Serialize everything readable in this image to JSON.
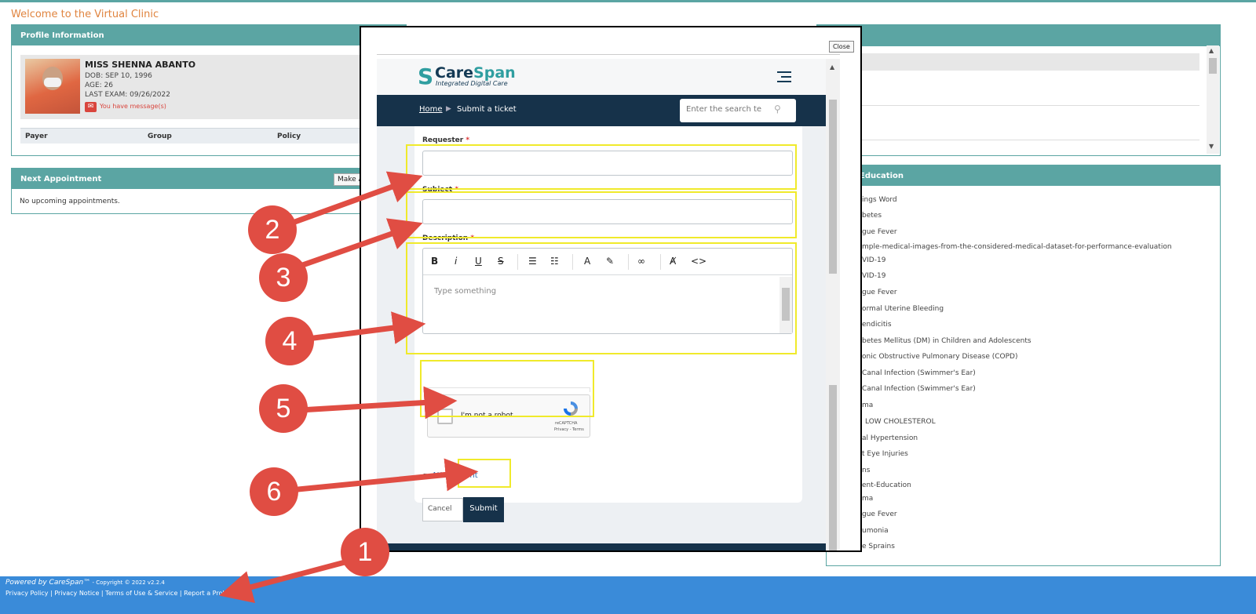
{
  "welcome": "Welcome to the Virtual Clinic",
  "profile": {
    "title": "Profile Information",
    "name": "MISS SHENNA ABANTO",
    "dob": "DOB: SEP 10, 1996",
    "age": "AGE: 26",
    "last_exam": "LAST EXAM: 09/26/2022",
    "message": "You have message(s)",
    "table_headers": [
      "Payer",
      "Group",
      "Policy"
    ]
  },
  "appointment": {
    "title": "Next Appointment",
    "make_button": "Make A",
    "empty": "No upcoming appointments."
  },
  "education": {
    "title": "Education",
    "items": [
      "ings Word",
      "betes",
      "gue Fever",
      "mple-medical-images-from-the-considered-medical-dataset-for-performance-evaluation",
      "VID-19",
      "VID-19",
      "gue Fever",
      "ormal Uterine Bleeding",
      "endicitis",
      "betes Mellitus (DM) in Children and Adolescents",
      "onic Obstructive Pulmonary Disease (COPD)",
      "Canal Infection (Swimmer's Ear)",
      "Canal Infection (Swimmer's Ear)",
      "ma",
      "LOW CHOLESTEROL",
      "al Hypertension",
      "t Eye Injuries",
      "ns",
      "ent-Education",
      "ma",
      "gue Fever",
      "umonia",
      "e Sprains"
    ]
  },
  "footer": {
    "powered": "Powered by CareSpan™",
    "copyright": " - Copyright © 2022 v2.2.4",
    "links": [
      "Privacy Policy",
      "Privacy Notice",
      "Terms of Use & Service",
      "Report a Proble"
    ]
  },
  "modal": {
    "close": "Close",
    "logo_name_1": "Care",
    "logo_name_2": "Span",
    "logo_tag": "Integrated Digital Care",
    "breadcrumb_home": "Home",
    "breadcrumb_current": "Submit a ticket",
    "search_placeholder": "Enter the search te",
    "requester_label": "Requester",
    "subject_label": "Subject",
    "description_label": "Description",
    "required_mark": "*",
    "editor_placeholder": "Type something",
    "captcha_text": "I'm not a robot",
    "captcha_brand": "reCAPTCHA",
    "captcha_terms": "Privacy - Terms",
    "attachment": "Attachment",
    "cancel": "Cancel",
    "submit": "Submit"
  },
  "annotations": [
    "1",
    "2",
    "3",
    "4",
    "5",
    "6"
  ],
  "colors": {
    "teal": "#5ba5a3",
    "footer_blue": "#3a8bd9",
    "navy": "#16324a",
    "highlight_yellow": "#f0ea2b",
    "annotation_red": "#e04d43"
  }
}
